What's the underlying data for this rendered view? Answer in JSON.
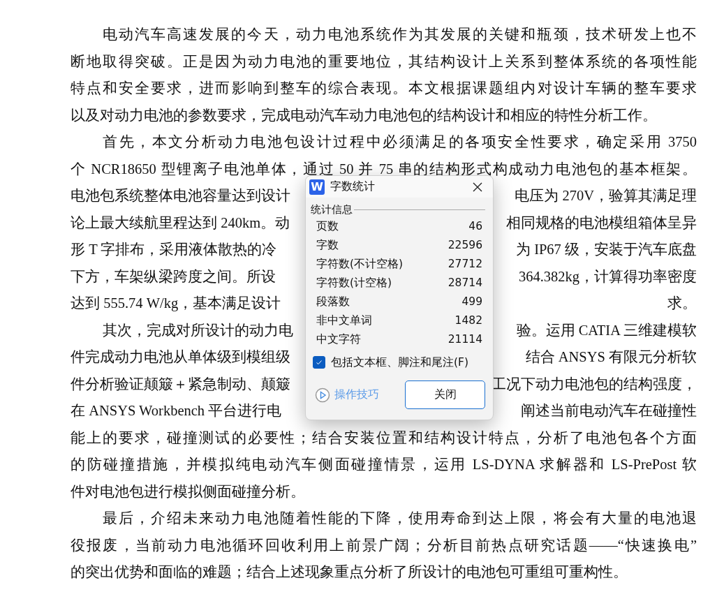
{
  "document": {
    "paragraphs": [
      {
        "lines": [
          {
            "segments": [
              "电动汽车高速发展的今天，动力电池系统作为其发展的关键和瓶颈，技术研发上也不"
            ]
          },
          {
            "segments": [
              "断地取得突破。正是因为动力电池的重要地位，其结构设计上关系到整体系统的各项性能"
            ]
          },
          {
            "segments": [
              "特点和安全要求，进而影响到整车的综合表现。本文根据课题组内对设计车辆的整车要求"
            ]
          },
          {
            "segments": [
              "以及对动力电池的参数要求，完成电动汽车动力电池包的结构设计和相应的特性分析工作。"
            ]
          }
        ]
      },
      {
        "lines": [
          {
            "segments": [
              "首先，本文分析动力电池包设计过程中必须满足的各项安全性要求，确定采用 3750"
            ]
          },
          {
            "segments": [
              "个 NCR18650 型锂离子电池单体，通过 50 并 75 串的结构形式构成动力电池包的基本框架。"
            ]
          },
          {
            "segments": [
              "电池包系统整体电池容量达到设计",
              "电压为 270V，验算其满足理"
            ]
          },
          {
            "segments": [
              "论上最大续航里程达到 240km。动",
              "相同规格的电池模组箱体呈异"
            ]
          },
          {
            "segments": [
              "形 T 字排布，采用液体散热的冷",
              "为 IP67 级，安装于汽车底盘"
            ]
          },
          {
            "segments": [
              "下方，车架纵梁跨度之间。所设",
              "364.382kg，计算得功率密度"
            ]
          },
          {
            "segments": [
              "达到 555.74 W/kg，基本满足设计",
              "求。"
            ]
          }
        ]
      },
      {
        "lines": [
          {
            "segments": [
              "其次，完成对所设计的动力电",
              "验。运用 CATIA 三维建模软"
            ]
          },
          {
            "segments": [
              "件完成动力电池从单体级到模组级",
              "结合 ANSYS 有限元分析软"
            ]
          },
          {
            "segments": [
              "件分析验证颠簸＋紧急制动、颠簸",
              "工况下动力电池包的结构强度，"
            ]
          },
          {
            "segments": [
              "在 ANSYS Workbench 平台进行电",
              "阐述当前电动汽车在碰撞性"
            ]
          },
          {
            "segments": [
              "能上的要求，碰撞测试的必要性；结合安装位置和结构设计特点，分析了电池包各个方面"
            ]
          },
          {
            "segments": [
              "的防碰撞措施，并模拟纯电动汽车侧面碰撞情景，运用 LS-DYNA 求解器和 LS-PrePost 软"
            ]
          },
          {
            "segments": [
              "件对电池包进行模拟侧面碰撞分析。"
            ]
          }
        ]
      },
      {
        "lines": [
          {
            "segments": [
              "最后，介绍未来动力电池随着性能的下降，使用寿命到达上限，将会有大量的电池退"
            ]
          },
          {
            "segments": [
              "役报废，当前动力电池循环回收利用上前景广阔；分析目前热点研究话题——“快速换电”"
            ]
          },
          {
            "segments": [
              "的突出优势和面临的难题；结合上述现象重点分析了所设计的电池包可重组可重构性。"
            ]
          }
        ]
      }
    ]
  },
  "dialog": {
    "app_icon": "W",
    "title": "字数统计",
    "group_title": "统计信息",
    "stats": [
      {
        "label": "页数",
        "value": "46"
      },
      {
        "label": "字数",
        "value": "22596"
      },
      {
        "label": "字符数(不计空格)",
        "value": "27712"
      },
      {
        "label": "字符数(计空格)",
        "value": "28714"
      },
      {
        "label": "段落数",
        "value": "499"
      },
      {
        "label": "非中文单词",
        "value": "1482"
      },
      {
        "label": "中文字符",
        "value": "21114"
      }
    ],
    "checkbox": {
      "label": "包括文本框、脚注和尾注(F)",
      "checked": true
    },
    "tips_link": "操作技巧",
    "close_button": "关闭"
  }
}
